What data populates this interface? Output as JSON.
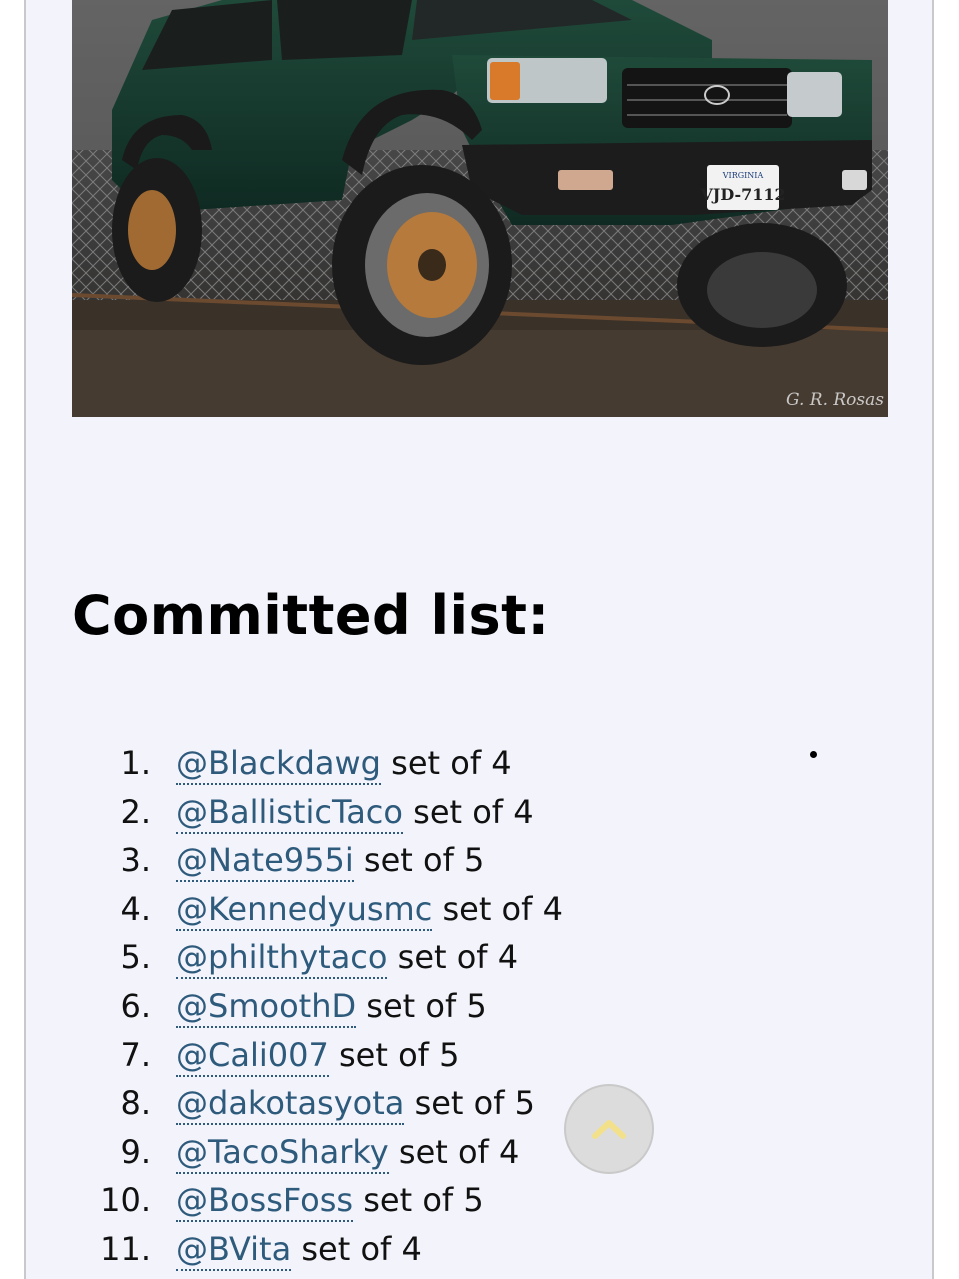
{
  "photo": {
    "alt": "Green Toyota 4Runner with bronze wheels and off-road tires",
    "license_state": "VIRGINIA",
    "license_plate": "VJD-7112",
    "watermark": "G. R. Rosas"
  },
  "section": {
    "heading": "Committed list:"
  },
  "committed": [
    {
      "num": "1.",
      "user": "@Blackdawg",
      "detail": " set of 4"
    },
    {
      "num": "2.",
      "user": "@BallisticTaco",
      "detail": " set of 4"
    },
    {
      "num": "3.",
      "user": "@Nate955i",
      "detail": " set of 5"
    },
    {
      "num": "4.",
      "user": "@Kennedyusmc",
      "detail": " set of 4"
    },
    {
      "num": "5.",
      "user": "@philthytaco",
      "detail": " set of 4"
    },
    {
      "num": "6.",
      "user": "@SmoothD",
      "detail": " set of 5"
    },
    {
      "num": "7.",
      "user": "@Cali007",
      "detail": " set of 5"
    },
    {
      "num": "8.",
      "user": "@dakotasyota",
      "detail": " set of 5"
    },
    {
      "num": "9.",
      "user": "@TacoSharky",
      "detail": " set of 4"
    },
    {
      "num": "10.",
      "user": "@BossFoss",
      "detail": " set of 5"
    },
    {
      "num": "11.",
      "user": "@BVita",
      "detail": " set of 4"
    }
  ],
  "scroll_top": {
    "icon": "chevron-up-icon",
    "color": "#f2e08a"
  },
  "colors": {
    "link": "#2e5a7c",
    "page_bg": "#f3f4fb"
  }
}
